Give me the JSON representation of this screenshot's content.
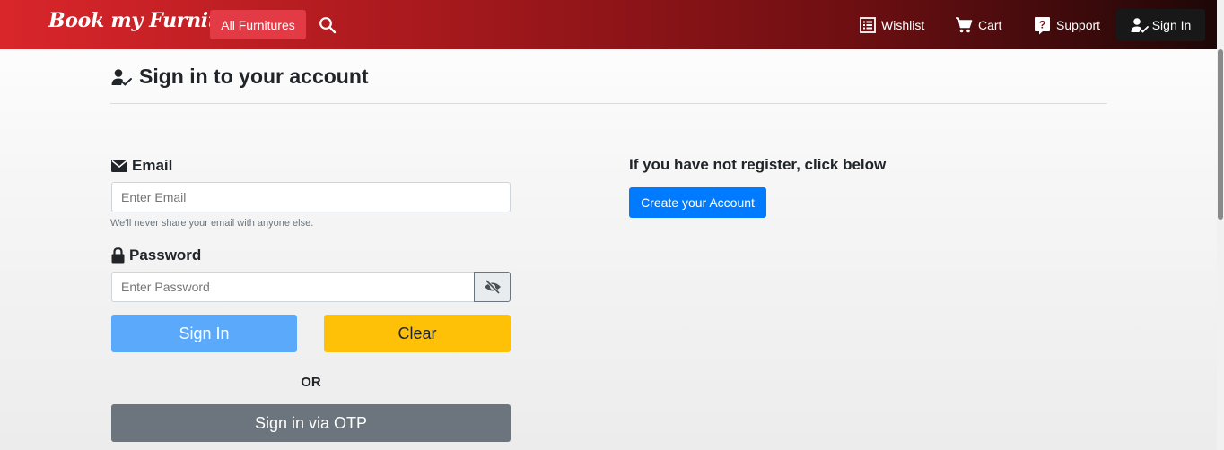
{
  "navbar": {
    "brand": "Book my Furniture",
    "all_furnitures": "All Furnitures",
    "search_icon": "search-icon",
    "wishlist": "Wishlist",
    "cart": "Cart",
    "support": "Support",
    "sign_in": "Sign In",
    "colors": {
      "gradient_start": "#d9262b",
      "gradient_end": "#1e0707",
      "pill": "#e33b45"
    }
  },
  "page": {
    "title": "Sign in to your account"
  },
  "form": {
    "email_label": "Email",
    "email_placeholder": "Enter Email",
    "email_value": "",
    "email_help": "We'll never share your email with anyone else.",
    "password_label": "Password",
    "password_placeholder": "Enter Password",
    "password_value": "",
    "sign_in_button": "Sign In",
    "clear_button": "Clear",
    "or_text": "OR",
    "otp_button": "Sign in via OTP"
  },
  "register": {
    "prompt": "If you have not register, click below",
    "create_button": "Create your Account"
  },
  "colors": {
    "primary": "#007bff",
    "sign_in": "#5aa9fb",
    "warning": "#ffc107",
    "secondary": "#6c757d"
  }
}
